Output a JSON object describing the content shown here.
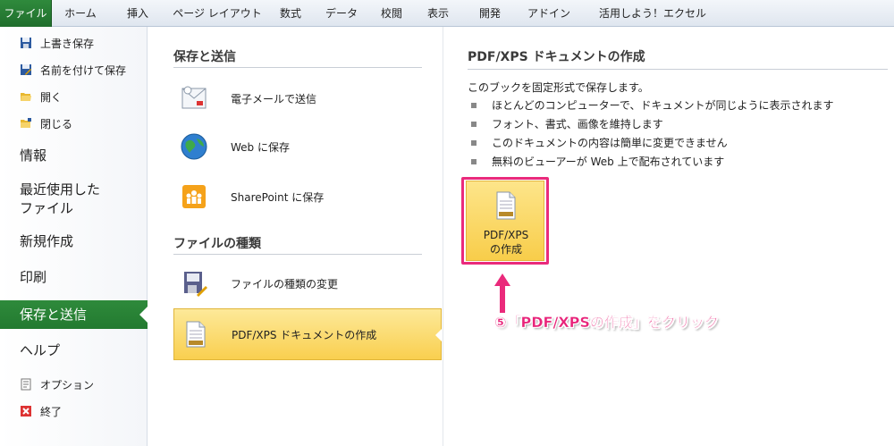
{
  "ribbon": {
    "tabs": [
      {
        "label": "ファイル",
        "active": true
      },
      {
        "label": "ホーム"
      },
      {
        "label": "挿入"
      },
      {
        "label": "ページ レイアウト"
      },
      {
        "label": "数式"
      },
      {
        "label": "データ"
      },
      {
        "label": "校閲"
      },
      {
        "label": "表示"
      },
      {
        "label": "開発"
      },
      {
        "label": "アドイン"
      },
      {
        "label": "活用しよう！エクセル"
      }
    ]
  },
  "nav": {
    "save": "上書き保存",
    "save_as": "名前を付けて保存",
    "open": "開く",
    "close": "閉じる",
    "info": "情報",
    "recent_line1": "最近使用した",
    "recent_line2": "ファイル",
    "new": "新規作成",
    "print": "印刷",
    "save_send": "保存と送信",
    "help": "ヘルプ",
    "options": "オプション",
    "exit": "終了"
  },
  "middle": {
    "section1_title": "保存と送信",
    "email": "電子メールで送信",
    "web": "Web に保存",
    "sharepoint": "SharePoint に保存",
    "section2_title": "ファイルの種類",
    "change_type": "ファイルの種類の変更",
    "pdf_xps": "PDF/XPS ドキュメントの作成"
  },
  "right": {
    "title": "PDF/XPS ドキュメントの作成",
    "description": "このブックを固定形式で保存します。",
    "bullets": [
      "ほとんどのコンピューターで、ドキュメントが同じように表示されます",
      "フォント、書式、画像を維持します",
      "このドキュメントの内容は簡単に変更できません",
      "無料のビューアーが Web 上で配布されています"
    ],
    "button_line1": "PDF/XPS",
    "button_line2": "の作成"
  },
  "annotation": {
    "text": "⑤「PDF/XPSの作成」をクリック"
  },
  "colors": {
    "accent_green": "#2f8a3c",
    "highlight_yellow": "#f9cf4f",
    "annotation_pink": "#e8247a"
  }
}
